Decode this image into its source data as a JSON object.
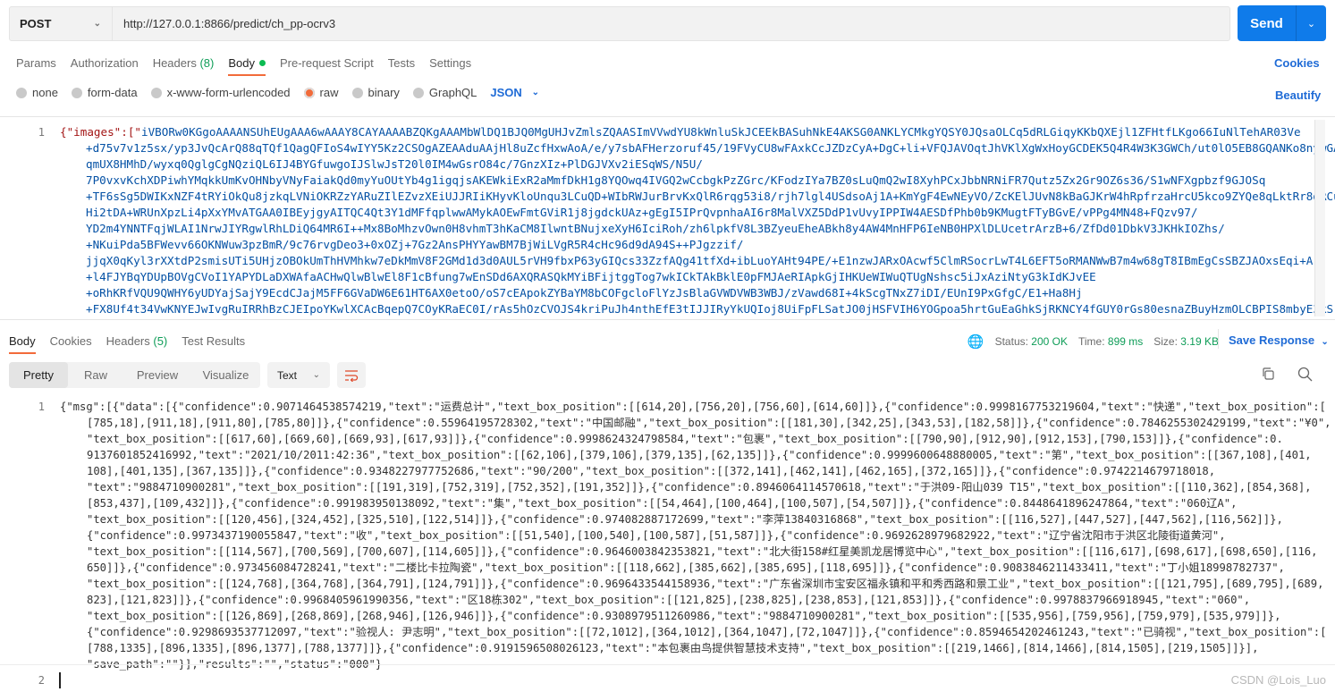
{
  "request": {
    "method": "POST",
    "url": "http://127.0.0.1:8866/predict/ch_pp-ocrv3",
    "send_label": "Send",
    "tabs": [
      {
        "label": "Params"
      },
      {
        "label": "Authorization"
      },
      {
        "label": "Headers",
        "count": "(8)"
      },
      {
        "label": "Body"
      },
      {
        "label": "Pre-request Script"
      },
      {
        "label": "Tests"
      },
      {
        "label": "Settings"
      }
    ],
    "cookies_link": "Cookies",
    "body_types": [
      "none",
      "form-data",
      "x-www-form-urlencoded",
      "raw",
      "binary",
      "GraphQL"
    ],
    "selected_body_type": "raw",
    "format": "JSON",
    "beautify_link": "Beautify",
    "body_line_number": "1",
    "body_key_open": "{\"images\":[\"",
    "body_lines": [
      "iVBORw0KGgoAAAANSUhEUgAAA6wAAAY8CAYAAAABZQKgAAAMbWlDQ1BJQ0MgUHJvZmlsZQAASImVVwdYU8kWnluSkJCEEkBASuhNkE4AKSG0ANKLYCMkgYQSY0JQsaOLCq5dRLGiqyKKbQXEjl1ZFHtfLKgo66IuNlTehAR03Ve",
      "+d75v7v1z5sx/yp3JvQcArQ88qTQf1QagQFIoS4wIYY5Kz2CSOgAZEAAduAAjHl8uZcfHxwAoA/e/y7sbAFHerzoruf45/19FVyCU8wFAxkCcJZDzCyA+DgC+li+VFQJAVOqtJhVKlXgWxHoyGCDEK5Q4R4W3K3GWCh/ut0lO5EB8GQANKo8nywGAfg/",
      "qmUX8HMhD/wyxq0QglgCgNQziQL6IJ4BYGfuwgoIJSlwJsT20l0IM4wGsrO84c/7GnzXIz+PlDGJVXv2iESqWS/N5U/",
      "7P0vxvKchXDPiwhYMqkkUmKvOHNbyVNyFaiakQd0myYuOUtYb4g1igqjsAKEWkiExR2aMmfDkH1g8YQOwq4IVGQ2wCcbgkPzZGrc/KFodzIYa7BZ0sLuQmQ2wI8XyhPCxJbbNRNiFR7Qutz5Zx2Gr9OZ6s36/S1wNFXgpbzf9GJOSq",
      "+TF6sSg5DWIKxNZF4tRYiOkQu8jzkqLVNiOKRZzYARuZIlEZvzXEiUJJRIiKHyvKloUnqu3LCuQD+WIbRWJurBrvKxQlR6rqg53i8/rjh7lgl4USdsoAj1A+KmYgF4EwNEyVO/ZcKElJUvN8kBaGJKrW4hRpfrzaHrcU5kco9ZYQe8qLktRr8dRCuDlV/",
      "Hi2tDA+WRUnXpzLi4pXxYMvATGAA0IBEyjgyAITQC4Qt3Y1dMFfqplwwAMykAOEwFmtGViR1j8jgdckUAz+gEgI5IPrQvpnhaAI6r8MalVXZ5DdP1vUvyIPPIW4AESDfPhb0b9KMugtFTyBGvE/vPPg4MN48+FQzv97/",
      "YD2m4YNNTFqjWLAI1NrwJIYRgwlRhLDiQ64MR6I++Mx8BoMhzvOwn0H8vhmT3hKaCM8IlwntBNujxeXyH6IciRoh/zh6lpkfV8L3BZyeuEheABkh8y4AW4MnHFP6IeNB0HPXlDLUcetrArzB+6/ZfDd01DbkV3JKHkIOZhs/",
      "+NKuiPda5BFWevv66OKNWuw3pzBmR/9c76rvgDeo3+0xOZj+7Gz2AnsPHYYawBM7BjWiLVgR5R4cHc96d9dA94S++PJgzzif/",
      "jjqX0qKyl3rXXtdP2smisUTi5UHjzOBOkUmThHVMhkw7eDkMmV8F2GMd1d3d0AUL5rVH9fbxP63yGIQcs33ZzfAQg41tfXd+ibLuoYAHt94PE/+E1nzwJARxOAcwf5ClmRSocrLwT4L6EFT5oRMANWwB7m4w68gT8IBmEgCsSBZJAOxsEqi+A",
      "+l4FJYBqYDUpBOVgCVoI1YAPYDLaDXWAfaACHwQlwBlwEl8F1cBfung7wEnSDd6AXQRASQkMYiBFijtggTog7wkICkTAkBklE0pFMJAeRIApkGjIHKUeWIWuQTUgNshsc5iJxAziNtyG3kIdKJvEE",
      "+oRhKRfVQU9QWHY6yUDYajSajY9EcdCJajM5FF6GVaDW6E61HT6AX0etoO/oS7cEApokZYBaYM8bCOFgcloFlYzJsBlaGVWDVWB3WBJ/zVawd68I+4kScgTNxZ7iDI/EUnI9PxGfgC/E1+Ha8Hj",
      "+FX8Uf4t34VwKNYEJwIvgRuIRRhBzCJEIpoYKwlXCAcBqepQ7COyKRaEC0I/rAs5hOzCVOJS4kriPuJh4nthEfE3tIJJIRyYkUQIoj8UiFpFLSatJO0jHSFVIH6YOGpoa5hrtGuEaGhkSjRKNCY4fGUY0rGs80esnaZBuyHzmOLCBPIS8mbyE3kS"
    ]
  },
  "response": {
    "tabs": [
      {
        "label": "Body"
      },
      {
        "label": "Cookies"
      },
      {
        "label": "Headers",
        "count": "(5)"
      },
      {
        "label": "Test Results"
      }
    ],
    "status_label": "Status:",
    "status_value": "200 OK",
    "time_label": "Time:",
    "time_value": "899 ms",
    "size_label": "Size:",
    "size_value": "3.19 KB",
    "save_response": "Save Response",
    "view_modes": [
      "Pretty",
      "Raw",
      "Preview",
      "Visualize"
    ],
    "selected_view": "Pretty",
    "format": "Text",
    "line_numbers": [
      "1",
      "2"
    ],
    "body_lines": [
      "{\"msg\":[{\"data\":[{\"confidence\":0.9071464538574219,\"text\":\"运费总计\",\"text_box_position\":[[614,20],[756,20],[756,60],[614,60]]},{\"confidence\":0.9998167753219604,\"text\":\"快递\",\"text_box_position\":[",
      "[785,18],[911,18],[911,80],[785,80]]},{\"confidence\":0.55964195728302,\"text\":\"中国邮融\",\"text_box_position\":[[181,30],[342,25],[343,53],[182,58]]},{\"confidence\":0.7846255302429199,\"text\":\"¥0\",",
      "\"text_box_position\":[[617,60],[669,60],[669,93],[617,93]]},{\"confidence\":0.9998624324798584,\"text\":\"包裹\",\"text_box_position\":[[790,90],[912,90],[912,153],[790,153]]},{\"confidence\":0.",
      "9137601852416992,\"text\":\"2021/10/2011:42:36\",\"text_box_position\":[[62,106],[379,106],[379,135],[62,135]]},{\"confidence\":0.9999600648880005,\"text\":\"第\",\"text_box_position\":[[367,108],[401,",
      "108],[401,135],[367,135]]},{\"confidence\":0.9348227977752686,\"text\":\"90/200\",\"text_box_position\":[[372,141],[462,141],[462,165],[372,165]]},{\"confidence\":0.9742214679718018,",
      "\"text\":\"9884710900281\",\"text_box_position\":[[191,319],[752,319],[752,352],[191,352]]},{\"confidence\":0.8946064114570618,\"text\":\"于洪09-阳山039 T15\",\"text_box_position\":[[110,362],[854,368],",
      "[853,437],[109,432]]},{\"confidence\":0.991983950138092,\"text\":\"集\",\"text_box_position\":[[54,464],[100,464],[100,507],[54,507]]},{\"confidence\":0.8448641896247864,\"text\":\"060辽A\",",
      "\"text_box_position\":[[120,456],[324,452],[325,510],[122,514]]},{\"confidence\":0.974082887172699,\"text\":\"李萍13840316868\",\"text_box_position\":[[116,527],[447,527],[447,562],[116,562]]},",
      "{\"confidence\":0.9973437190055847,\"text\":\"收\",\"text_box_position\":[[51,540],[100,540],[100,587],[51,587]]},{\"confidence\":0.9692628979682922,\"text\":\"辽宁省沈阳市于洪区北陵街道黄河\",",
      "\"text_box_position\":[[114,567],[700,569],[700,607],[114,605]]},{\"confidence\":0.9646003842353821,\"text\":\"北大街158#红星美凯龙居博览中心\",\"text_box_position\":[[116,617],[698,617],[698,650],[116,",
      "650]]},{\"confidence\":0.973456084728241,\"text\":\"二楼比卡拉陶瓷\",\"text_box_position\":[[118,662],[385,662],[385,695],[118,695]]},{\"confidence\":0.9083846211433411,\"text\":\"丁小姐18998782737\",",
      "\"text_box_position\":[[124,768],[364,768],[364,791],[124,791]]},{\"confidence\":0.9696433544158936,\"text\":\"广东省深圳市宝安区福永镇和平和秀西路和景工业\",\"text_box_position\":[[121,795],[689,795],[689,",
      "823],[121,823]]},{\"confidence\":0.9968405961990356,\"text\":\"区18栋302\",\"text_box_position\":[[121,825],[238,825],[238,853],[121,853]]},{\"confidence\":0.9978837966918945,\"text\":\"060\",",
      "\"text_box_position\":[[126,869],[268,869],[268,946],[126,946]]},{\"confidence\":0.9308979511260986,\"text\":\"9884710900281\",\"text_box_position\":[[535,956],[759,956],[759,979],[535,979]]},",
      "{\"confidence\":0.9298693537712097,\"text\":\"验视人: 尹志明\",\"text_box_position\":[[72,1012],[364,1012],[364,1047],[72,1047]]},{\"confidence\":0.8594654202461243,\"text\":\"已骑视\",\"text_box_position\":[",
      "[788,1335],[896,1335],[896,1377],[788,1377]]},{\"confidence\":0.9191596508026123,\"text\":\"本包裹由鸟提供智慧技术支持\",\"text_box_position\":[[219,1466],[814,1466],[814,1505],[219,1505]]}],",
      "\"save_path\":\"\"}],\"results\":\"\",\"status\":\"000\"}"
    ]
  },
  "watermark": "CSDN @Lois_Luo",
  "colors": {
    "accent": "#0f7bea",
    "tab_underline": "#f26b3a",
    "status_ok": "#0f9d58",
    "link": "#1f6bd6"
  }
}
